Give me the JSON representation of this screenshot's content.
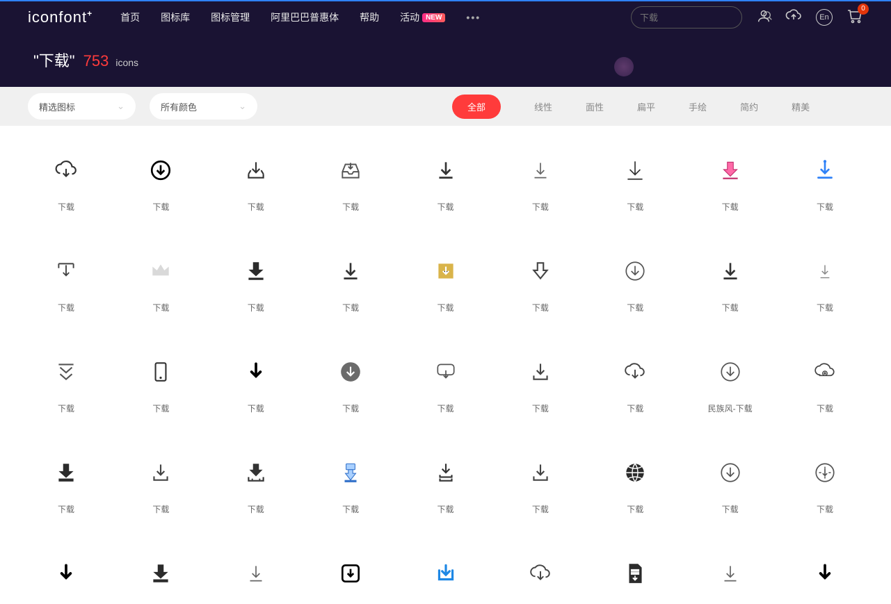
{
  "logo": "iconfont",
  "nav": [
    "首页",
    "图标库",
    "图标管理",
    "阿里巴巴普惠体",
    "帮助",
    "活动"
  ],
  "new_badge": "NEW",
  "more": "•••",
  "search_placeholder": "下载",
  "lang": "En",
  "cart_count": "0",
  "search": {
    "term": "\"下载\"",
    "count": "753",
    "unit": "icons"
  },
  "dropdown1": "精选图标",
  "dropdown2": "所有颜色",
  "filters": [
    "全部",
    "线性",
    "面性",
    "扁平",
    "手绘",
    "简约",
    "精美"
  ],
  "active_filter": 0,
  "rows": [
    [
      {
        "label": "下载",
        "svg": "cloud-down"
      },
      {
        "label": "下载",
        "svg": "circle-arrow"
      },
      {
        "label": "下载",
        "svg": "tray-down"
      },
      {
        "label": "下载",
        "svg": "inbox"
      },
      {
        "label": "下载",
        "svg": "arrow-base"
      },
      {
        "label": "下载",
        "svg": "arrow-base-thin"
      },
      {
        "label": "下载",
        "svg": "arrow-baseline"
      },
      {
        "label": "下载",
        "svg": "pink-arrow"
      },
      {
        "label": "下载",
        "svg": "blue-arrow"
      }
    ],
    [
      {
        "label": "下载",
        "svg": "bracket-down"
      },
      {
        "label": "下载",
        "svg": "crown"
      },
      {
        "label": "下载",
        "svg": "solid-bar"
      },
      {
        "label": "下载",
        "svg": "arrow-base"
      },
      {
        "label": "下载",
        "svg": "gold-square"
      },
      {
        "label": "下载",
        "svg": "fat-arrow-outline"
      },
      {
        "label": "下载",
        "svg": "circle-thin"
      },
      {
        "label": "下载",
        "svg": "arrow-base"
      },
      {
        "label": "下载",
        "svg": "arrow-base-small"
      }
    ],
    [
      {
        "label": "下载",
        "svg": "double-chevron"
      },
      {
        "label": "下载",
        "svg": "tablet"
      },
      {
        "label": "下载",
        "svg": "arrow-bold"
      },
      {
        "label": "下载",
        "svg": "circle-solid"
      },
      {
        "label": "下载",
        "svg": "speech"
      },
      {
        "label": "下载",
        "svg": "arrow-tray"
      },
      {
        "label": "下载",
        "svg": "cloud-arrow"
      },
      {
        "label": "民族风-下载",
        "svg": "circle-thin"
      },
      {
        "label": "下载",
        "svg": "cloud-dot"
      }
    ],
    [
      {
        "label": "下载",
        "svg": "solid-base"
      },
      {
        "label": "下载",
        "svg": "arrow-tray"
      },
      {
        "label": "下载",
        "svg": "tray-dots"
      },
      {
        "label": "下载",
        "svg": "blue-device"
      },
      {
        "label": "下载",
        "svg": "tray-double"
      },
      {
        "label": "下载",
        "svg": "arrow-tray"
      },
      {
        "label": "下载",
        "svg": "globe"
      },
      {
        "label": "下载",
        "svg": "circle-thin"
      },
      {
        "label": "下载",
        "svg": "compass"
      }
    ],
    [
      {
        "label": "",
        "svg": "arrow-bold"
      },
      {
        "label": "",
        "svg": "solid-base"
      },
      {
        "label": "",
        "svg": "arrow-base-thin"
      },
      {
        "label": "",
        "svg": "square-outline"
      },
      {
        "label": "",
        "svg": "blue-bracket"
      },
      {
        "label": "",
        "svg": "cloud-arrow"
      },
      {
        "label": "",
        "svg": "document"
      },
      {
        "label": "",
        "svg": "arrow-base-thin"
      },
      {
        "label": "",
        "svg": "arrow-bold"
      }
    ]
  ]
}
